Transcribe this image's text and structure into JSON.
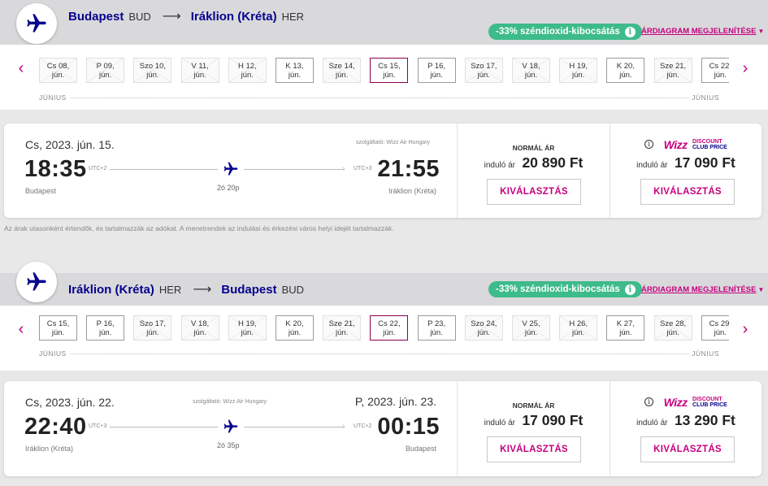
{
  "colors": {
    "brand_navy": "#06038d",
    "brand_pink": "#c6007e",
    "co2_green": "#3dbb8a"
  },
  "icons": {
    "route": "airplane-icon",
    "info": "info-icon",
    "prev": "chevron-left-icon",
    "next": "chevron-right-icon"
  },
  "routes": [
    {
      "header": {
        "origin_city": "Budapest",
        "origin_code": "BUD",
        "arrow": "⟶",
        "dest_city": "Iráklion (Kréta)",
        "dest_code": "HER",
        "co2": "-33% széndioxid-kibocsátás",
        "fare_chart_link": "ÁRDIAGRAM MEGJELENÍTÉSE"
      },
      "dates": [
        {
          "day": "Cs 08,",
          "month": "jún.",
          "state": "nofl"
        },
        {
          "day": "P 09,",
          "month": "jún.",
          "state": "nofl"
        },
        {
          "day": "Szo 10,",
          "month": "jún.",
          "state": "nofl"
        },
        {
          "day": "V 11,",
          "month": "jún.",
          "state": "nofl"
        },
        {
          "day": "H 12,",
          "month": "jún.",
          "state": "nofl"
        },
        {
          "day": "K 13,",
          "month": "jún.",
          "state": "avail"
        },
        {
          "day": "Sze 14,",
          "month": "jún.",
          "state": "nofl"
        },
        {
          "day": "Cs 15,",
          "month": "jún.",
          "state": "sel"
        },
        {
          "day": "P 16,",
          "month": "jún.",
          "state": "avail"
        },
        {
          "day": "Szo 17,",
          "month": "jún.",
          "state": "nofl"
        },
        {
          "day": "V 18,",
          "month": "jún.",
          "state": "nofl"
        },
        {
          "day": "H 19,",
          "month": "jún.",
          "state": "nofl"
        },
        {
          "day": "K 20,",
          "month": "jún.",
          "state": "avail"
        },
        {
          "day": "Sze 21,",
          "month": "jún.",
          "state": "nofl"
        },
        {
          "day": "Cs 22,",
          "month": "jún.",
          "state": "avail"
        }
      ],
      "month_label_left": "JÚNIUS",
      "month_label_right": "JÚNIUS",
      "flight": {
        "dep_date": "Cs, 2023. jún. 15.",
        "arr_date": "",
        "operator": "szolgáltató: Wizz Air Hungary",
        "dep_time": "18:35",
        "dep_tz": "UTC+2",
        "arr_time": "21:55",
        "arr_tz": "UTC+3",
        "duration": "2ó 20p",
        "dep_city": "Budapest",
        "arr_city": "Iráklion (Kréta)"
      },
      "fares": {
        "normal_title": "NORMÁL ÁR",
        "from_label": "induló ár",
        "normal_price": "20 890 Ft",
        "club_logo_word": "Wizz",
        "club_logo_line1": "DISCOUNT",
        "club_logo_line2": "CLUB PRICE",
        "club_price": "17 090 Ft",
        "select_label": "KIVÁLASZTÁS"
      }
    },
    {
      "header": {
        "origin_city": "Iráklion (Kréta)",
        "origin_code": "HER",
        "arrow": "⟶",
        "dest_city": "Budapest",
        "dest_code": "BUD",
        "co2": "-33% széndioxid-kibocsátás",
        "fare_chart_link": "ÁRDIAGRAM MEGJELENÍTÉSE"
      },
      "dates": [
        {
          "day": "Cs 15,",
          "month": "jún.",
          "state": "avail"
        },
        {
          "day": "P 16,",
          "month": "jún.",
          "state": "avail"
        },
        {
          "day": "Szo 17,",
          "month": "jún.",
          "state": "nofl"
        },
        {
          "day": "V 18,",
          "month": "jún.",
          "state": "nofl"
        },
        {
          "day": "H 19,",
          "month": "jún.",
          "state": "nofl"
        },
        {
          "day": "K 20,",
          "month": "jún.",
          "state": "avail"
        },
        {
          "day": "Sze 21,",
          "month": "jún.",
          "state": "nofl"
        },
        {
          "day": "Cs 22,",
          "month": "jún.",
          "state": "sel"
        },
        {
          "day": "P 23,",
          "month": "jún.",
          "state": "avail"
        },
        {
          "day": "Szo 24,",
          "month": "jún.",
          "state": "nofl"
        },
        {
          "day": "V 25,",
          "month": "jún.",
          "state": "nofl"
        },
        {
          "day": "H 26,",
          "month": "jún.",
          "state": "nofl"
        },
        {
          "day": "K 27,",
          "month": "jún.",
          "state": "avail"
        },
        {
          "day": "Sze 28,",
          "month": "jún.",
          "state": "nofl"
        },
        {
          "day": "Cs 29,",
          "month": "jún.",
          "state": "avail"
        }
      ],
      "month_label_left": "JÚNIUS",
      "month_label_right": "JÚNIUS",
      "flight": {
        "dep_date": "Cs, 2023. jún. 22.",
        "arr_date": "P, 2023. jún. 23.",
        "operator": "szolgáltató: Wizz Air Hungary",
        "dep_time": "22:40",
        "dep_tz": "UTC+3",
        "arr_time": "00:15",
        "arr_tz": "UTC+2",
        "duration": "2ó 35p",
        "dep_city": "Iráklion (Kréta)",
        "arr_city": "Budapest"
      },
      "fares": {
        "normal_title": "NORMÁL ÁR",
        "from_label": "induló ár",
        "normal_price": "17 090 Ft",
        "club_logo_word": "Wizz",
        "club_logo_line1": "DISCOUNT",
        "club_logo_line2": "CLUB PRICE",
        "club_price": "13 290 Ft",
        "select_label": "KIVÁLASZTÁS"
      }
    }
  ],
  "disclaimer": "Az árak utasonként értendők, és tartalmazzák az adókat. A menetrendek az indulási és érkezési város helyi idejét tartalmazzák."
}
